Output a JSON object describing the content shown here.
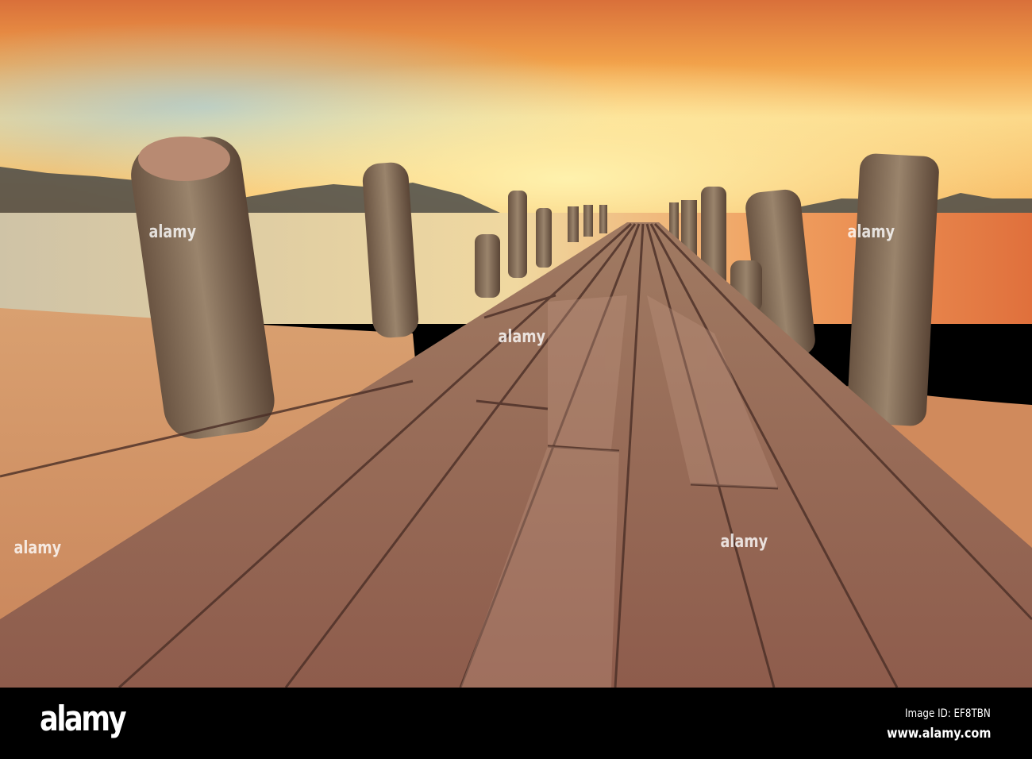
{
  "photo": {
    "subject": "weathered wooden pier at sunset",
    "colors": {
      "sky_top": "#e98a3c",
      "sky_glow": "#ffe08a",
      "sky_blue": "#9fc3cf",
      "water": "#d9c3a0",
      "water_right": "#e8743e",
      "sand": "#d99866",
      "wood": "#8a5a48",
      "wood_light": "#b0826c",
      "post": "#7a6350"
    }
  },
  "watermark": {
    "text": "alamy"
  },
  "footer": {
    "logo": "alamy",
    "image_id": "Image ID: EF8TBN",
    "url": "www.alamy.com"
  }
}
